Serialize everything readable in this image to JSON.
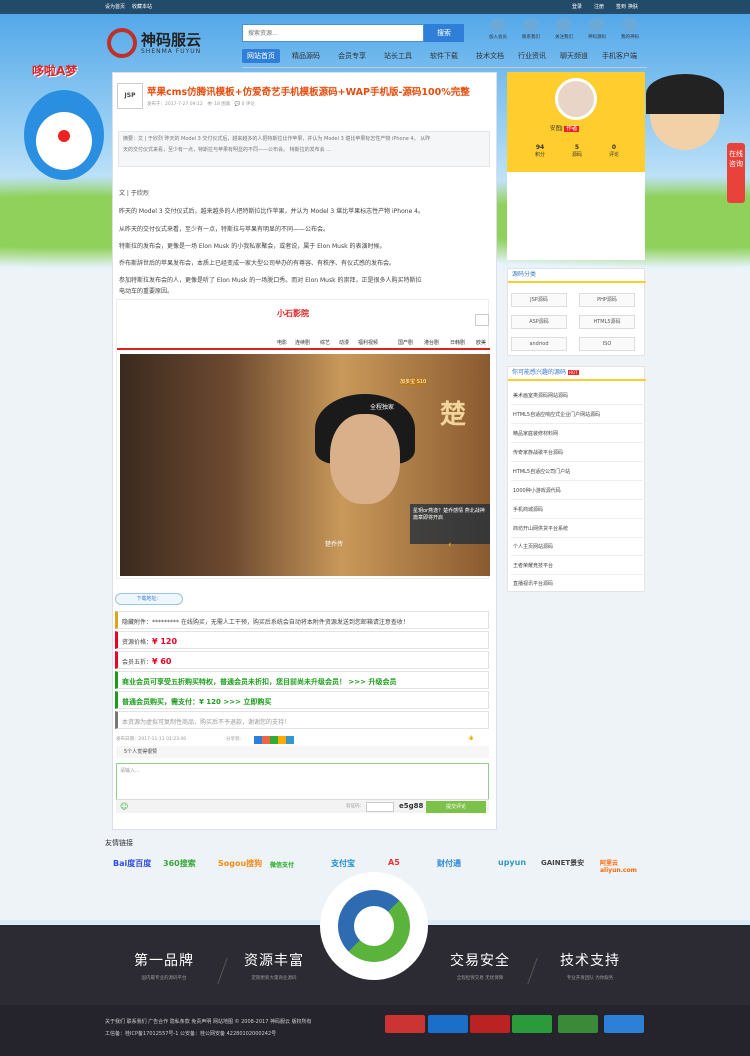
{
  "topbar": {
    "set_home": "设为首页",
    "bookmark": "收藏本站",
    "login": "登录",
    "register": "注册",
    "checkin": "签到",
    "switch": "换肤"
  },
  "logo": {
    "cn": "神码服云",
    "en": "SHENMA FUYUN",
    "deco": "哆啦A梦"
  },
  "search": {
    "placeholder": "搜索资源...",
    "button": "搜索"
  },
  "shortcuts": [
    "加入会员",
    "联系我们",
    "关注我们",
    "神码源码",
    "我的神码"
  ],
  "nav": [
    "网站首页",
    "精品源码",
    "会员专享",
    "站长工具",
    "软件下载",
    "技术文档",
    "行业资讯",
    "聊天频道",
    "手机客户端"
  ],
  "article": {
    "logo_text": "JSP",
    "title": "苹果cms仿腾讯模板+仿爱奇艺手机模板源码+WAP手机版-源码100%完整",
    "date": "发布于：2017-7-27 09:12",
    "views": "18 围观",
    "comments": "0 评论",
    "summary_1": "摘要：文 | 于欣烈 昨天的 Model 3 交付仪式后，越来越多的人把特斯拉比作苹果，并认为 Model 3 堪比苹果标志性产物 iPhone 4。 从昨",
    "summary_2": "天的交付仪式来看，至少有一点，特斯拉与苹果有明显的不同——公布会。 特斯拉的发布会 ...",
    "paras": [
      "文 | 于欣烈",
      "昨天的 Model 3 交付仪式后，越来越多的人把特斯拉比作苹果，并认为 Model 3 堪比苹果标志性产物 iPhone 4。",
      "从昨天的交付仪式来看，至少有一点，特斯拉与苹果有明显的不同——公布会。",
      "特斯拉的发布会，更像是一场 Elon Musk 的小我私家聚会，或者说，属于 Elon Musk 的表演时候。",
      "乔布斯辞世后的苹果发布会，本质上已经变成一家大型公司举办的有尊容、有秩序、有仪式感的发布会。",
      "参加特斯拉发布会的人，更像是听了 Elon Musk 的一场脱口秀。而对 Elon Musk 的崇拜，正是很多人购买特斯拉",
      "电动车的重要原因。"
    ]
  },
  "hero": {
    "site_logo": "小石影院",
    "menu": [
      "电影",
      "连续剧",
      "综艺",
      "动漫",
      "福利视频",
      "国产剧",
      "港台剧",
      "日韩剧",
      "欧美"
    ],
    "caption": "楚乔传",
    "badge": "星玥or燕逸？楚乔感情 燕北战神篇章即将开启",
    "poster_1": "全程独家",
    "poster_2": "楚",
    "tag": "加多宝 S10"
  },
  "download": {
    "tab": "下载地址：",
    "hidden": "隐藏附件：********* 在线购买，无需人工干预，购买后系统会自动将本附件资源发送到您邮箱请注意查收！",
    "price_label": "资源价格：",
    "price": "¥ 120",
    "vip_label": "会员五折：",
    "vip_price": "¥ 60",
    "promo": "商业会员可享受五折购买特权，普通会员未折扣，您目前尚未升级会员！ >>> 升级会员",
    "pay": "普通会员购买，需支付：¥ 120 >>> 立即购买",
    "notice": "本资源为虚拟可复制性商品，购买后不予退款，谢谢您的支持！"
  },
  "post_footer": {
    "date": "发布日期：2017-11-11 01:23:00",
    "share": "分享到：",
    "likers": "5个人觉得很赞"
  },
  "comment": {
    "placeholder": "请输入...",
    "verify_label": "验证码：",
    "verify_code": "e5g88",
    "submit": "提交评论"
  },
  "sidebar": {
    "user": {
      "name": "安图J",
      "badge": "作者",
      "stats": [
        {
          "value": "94",
          "label": "积分"
        },
        {
          "value": "5",
          "label": "源码"
        },
        {
          "value": "0",
          "label": "评论"
        }
      ]
    },
    "cat_title": "源码分类",
    "cats": [
      "JSP源码",
      "PHP源码",
      "ASP源码",
      "HTML5源码",
      "andriod",
      "ISO"
    ],
    "hot_title": "你可能感兴趣的源码",
    "hot_badge": "HOT",
    "hot": [
      "美术画室类源码网站源码",
      "HTML5自适应响应式企业门户网站源码",
      "精品家庭装修材料网",
      "传奇家族战歌平台源码",
      "HTML5自适应公司门户站",
      "1000种小游戏源代码",
      "手机商城源码",
      "商坊开山网供货平台系统",
      "个人主页网站源码",
      "王者荣耀竞技平台",
      "直播视讯平台源码"
    ]
  },
  "friend_links": {
    "title": "友情链接",
    "items": [
      "Bai度百度",
      "360搜索",
      "Sogou搜狗",
      "微信支付",
      "支付宝",
      "A5",
      "财付通",
      "upyun",
      "GAINET景安",
      "阿里云 aliyun.com"
    ]
  },
  "footer_blocks": [
    {
      "title": "第一品牌",
      "sub": "国内最专业的源码平台"
    },
    {
      "title": "资源丰富",
      "sub": "定期更新大量商业源码"
    },
    {
      "title": "交易安全",
      "sub": "全程担保交易 无忧保障"
    },
    {
      "title": "技术支持",
      "sub": "专业开发团队 为你服务"
    }
  ],
  "footer_links": "关于我们   联系我们   广告合作   隐私条款   免责声明   网站地图   © 2008-2017 神码服云 版权所有",
  "footer_icp": "工信备：桂ICP备17012557号-1 公安备：桂公网安备 42280102000242号",
  "float_tab": "在线咨询",
  "colors": {
    "accent": "#2f7fd9",
    "title": "#e84d0e",
    "price": "#e00022",
    "green": "#1a9e1a",
    "sidebar": "#ffce2e",
    "footer": "#25242c"
  }
}
